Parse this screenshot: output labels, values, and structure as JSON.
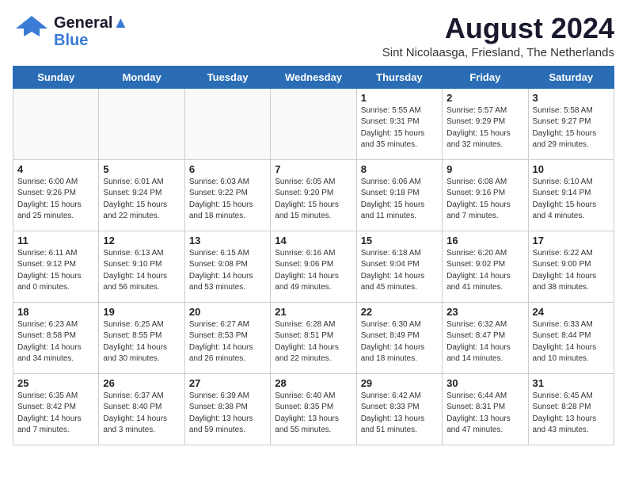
{
  "logo": {
    "line1": "General",
    "line2": "Blue",
    "tagline": ""
  },
  "title": "August 2024",
  "subtitle": "Sint Nicolaasga, Friesland, The Netherlands",
  "weekdays": [
    "Sunday",
    "Monday",
    "Tuesday",
    "Wednesday",
    "Thursday",
    "Friday",
    "Saturday"
  ],
  "weeks": [
    [
      {
        "day": "",
        "content": ""
      },
      {
        "day": "",
        "content": ""
      },
      {
        "day": "",
        "content": ""
      },
      {
        "day": "",
        "content": ""
      },
      {
        "day": "1",
        "content": "Sunrise: 5:55 AM\nSunset: 9:31 PM\nDaylight: 15 hours\nand 35 minutes."
      },
      {
        "day": "2",
        "content": "Sunrise: 5:57 AM\nSunset: 9:29 PM\nDaylight: 15 hours\nand 32 minutes."
      },
      {
        "day": "3",
        "content": "Sunrise: 5:58 AM\nSunset: 9:27 PM\nDaylight: 15 hours\nand 29 minutes."
      }
    ],
    [
      {
        "day": "4",
        "content": "Sunrise: 6:00 AM\nSunset: 9:26 PM\nDaylight: 15 hours\nand 25 minutes."
      },
      {
        "day": "5",
        "content": "Sunrise: 6:01 AM\nSunset: 9:24 PM\nDaylight: 15 hours\nand 22 minutes."
      },
      {
        "day": "6",
        "content": "Sunrise: 6:03 AM\nSunset: 9:22 PM\nDaylight: 15 hours\nand 18 minutes."
      },
      {
        "day": "7",
        "content": "Sunrise: 6:05 AM\nSunset: 9:20 PM\nDaylight: 15 hours\nand 15 minutes."
      },
      {
        "day": "8",
        "content": "Sunrise: 6:06 AM\nSunset: 9:18 PM\nDaylight: 15 hours\nand 11 minutes."
      },
      {
        "day": "9",
        "content": "Sunrise: 6:08 AM\nSunset: 9:16 PM\nDaylight: 15 hours\nand 7 minutes."
      },
      {
        "day": "10",
        "content": "Sunrise: 6:10 AM\nSunset: 9:14 PM\nDaylight: 15 hours\nand 4 minutes."
      }
    ],
    [
      {
        "day": "11",
        "content": "Sunrise: 6:11 AM\nSunset: 9:12 PM\nDaylight: 15 hours\nand 0 minutes."
      },
      {
        "day": "12",
        "content": "Sunrise: 6:13 AM\nSunset: 9:10 PM\nDaylight: 14 hours\nand 56 minutes."
      },
      {
        "day": "13",
        "content": "Sunrise: 6:15 AM\nSunset: 9:08 PM\nDaylight: 14 hours\nand 53 minutes."
      },
      {
        "day": "14",
        "content": "Sunrise: 6:16 AM\nSunset: 9:06 PM\nDaylight: 14 hours\nand 49 minutes."
      },
      {
        "day": "15",
        "content": "Sunrise: 6:18 AM\nSunset: 9:04 PM\nDaylight: 14 hours\nand 45 minutes."
      },
      {
        "day": "16",
        "content": "Sunrise: 6:20 AM\nSunset: 9:02 PM\nDaylight: 14 hours\nand 41 minutes."
      },
      {
        "day": "17",
        "content": "Sunrise: 6:22 AM\nSunset: 9:00 PM\nDaylight: 14 hours\nand 38 minutes."
      }
    ],
    [
      {
        "day": "18",
        "content": "Sunrise: 6:23 AM\nSunset: 8:58 PM\nDaylight: 14 hours\nand 34 minutes."
      },
      {
        "day": "19",
        "content": "Sunrise: 6:25 AM\nSunset: 8:55 PM\nDaylight: 14 hours\nand 30 minutes."
      },
      {
        "day": "20",
        "content": "Sunrise: 6:27 AM\nSunset: 8:53 PM\nDaylight: 14 hours\nand 26 minutes."
      },
      {
        "day": "21",
        "content": "Sunrise: 6:28 AM\nSunset: 8:51 PM\nDaylight: 14 hours\nand 22 minutes."
      },
      {
        "day": "22",
        "content": "Sunrise: 6:30 AM\nSunset: 8:49 PM\nDaylight: 14 hours\nand 18 minutes."
      },
      {
        "day": "23",
        "content": "Sunrise: 6:32 AM\nSunset: 8:47 PM\nDaylight: 14 hours\nand 14 minutes."
      },
      {
        "day": "24",
        "content": "Sunrise: 6:33 AM\nSunset: 8:44 PM\nDaylight: 14 hours\nand 10 minutes."
      }
    ],
    [
      {
        "day": "25",
        "content": "Sunrise: 6:35 AM\nSunset: 8:42 PM\nDaylight: 14 hours\nand 7 minutes."
      },
      {
        "day": "26",
        "content": "Sunrise: 6:37 AM\nSunset: 8:40 PM\nDaylight: 14 hours\nand 3 minutes."
      },
      {
        "day": "27",
        "content": "Sunrise: 6:39 AM\nSunset: 8:38 PM\nDaylight: 13 hours\nand 59 minutes."
      },
      {
        "day": "28",
        "content": "Sunrise: 6:40 AM\nSunset: 8:35 PM\nDaylight: 13 hours\nand 55 minutes."
      },
      {
        "day": "29",
        "content": "Sunrise: 6:42 AM\nSunset: 8:33 PM\nDaylight: 13 hours\nand 51 minutes."
      },
      {
        "day": "30",
        "content": "Sunrise: 6:44 AM\nSunset: 8:31 PM\nDaylight: 13 hours\nand 47 minutes."
      },
      {
        "day": "31",
        "content": "Sunrise: 6:45 AM\nSunset: 8:28 PM\nDaylight: 13 hours\nand 43 minutes."
      }
    ]
  ]
}
